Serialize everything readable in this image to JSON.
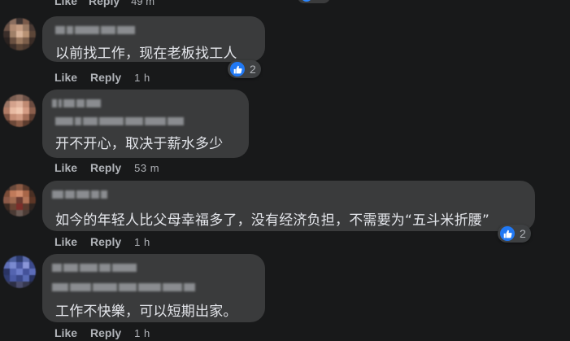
{
  "top": {
    "like": "Like",
    "reply": "Reply",
    "time": "49 m"
  },
  "comments": [
    {
      "text": "以前找工作，现在老板找工人",
      "like": "Like",
      "reply": "Reply",
      "time": "1 h",
      "reactions": "2",
      "avatar_colors": [
        "#5a4a44",
        "#8a6d5e",
        "#3e3432",
        "#7a5a4a",
        "#2c2624",
        "#6b5246",
        "#b08a72",
        "#c49c82",
        "#9a7a64",
        "#4a3a34",
        "#3a2e2a",
        "#a08068",
        "#d8b49a",
        "#b89274",
        "#5c4638",
        "#2a2220",
        "#6a5040",
        "#9c7a60",
        "#7c5e4a",
        "#3a2c26",
        "#201a18",
        "#3c2e28",
        "#5a4436",
        "#4c3a30",
        "#2e2420"
      ]
    },
    {
      "text": "开不开心，取决于薪水多少",
      "like": "Like",
      "reply": "Reply",
      "time": "53 m",
      "avatar_colors": [
        "#4a3c36",
        "#7a5e52",
        "#8c6c5e",
        "#6a5046",
        "#3c302c",
        "#9a7464",
        "#d4a28c",
        "#e0b29c",
        "#c08a72",
        "#6c4c40",
        "#b07c66",
        "#e8baa2",
        "#f0c8b0",
        "#d49c84",
        "#8a5e4c",
        "#7a5242",
        "#c48c74",
        "#d09a82",
        "#a46e58",
        "#5a3c30",
        "#4a3028",
        "#6c4838",
        "#8a5c48",
        "#5c3c2e",
        "#3c2820"
      ]
    },
    {
      "text": "如今的年轻人比父母幸福多了，没有经济负担，不需要为“五斗米折腰”",
      "like": "Like",
      "reply": "Reply",
      "time": "1 h",
      "reactions": "2",
      "avatar_colors": [
        "#3a2c28",
        "#6a4a3c",
        "#8a5a44",
        "#5a3a2c",
        "#2a201c",
        "#7a4c38",
        "#c07a5a",
        "#d08c6c",
        "#a86648",
        "#4a3024",
        "#8c5a48",
        "#a06a50",
        "#6a3a30",
        "#b27458",
        "#5c3626",
        "#3c2a22",
        "#6a4434",
        "#7c2e2a",
        "#5a3a2e",
        "#2e2420",
        "#2a2220",
        "#4a3a34",
        "#6a5a54",
        "#4c3c36",
        "#242020"
      ]
    },
    {
      "text": "工作不快樂，可以短期出家。",
      "like": "Like",
      "reply": "Reply",
      "time": "1 h",
      "avatar_colors": [
        "#3a4a7a",
        "#4a5c9a",
        "#2c3a6c",
        "#5a6aaa",
        "#34427a",
        "#6070b8",
        "#7a8ad0",
        "#4a58a0",
        "#8a96d8",
        "#3c4a8c",
        "#2a3464",
        "#5464b0",
        "#6c7cc8",
        "#44529a",
        "#5c6cb8",
        "#303c70",
        "#4a5aa4",
        "#3a4888",
        "#586ab4",
        "#283260",
        "#3a3c58",
        "#2c2e44",
        "#4a4c6c",
        "#36384e",
        "#24263a"
      ]
    }
  ]
}
